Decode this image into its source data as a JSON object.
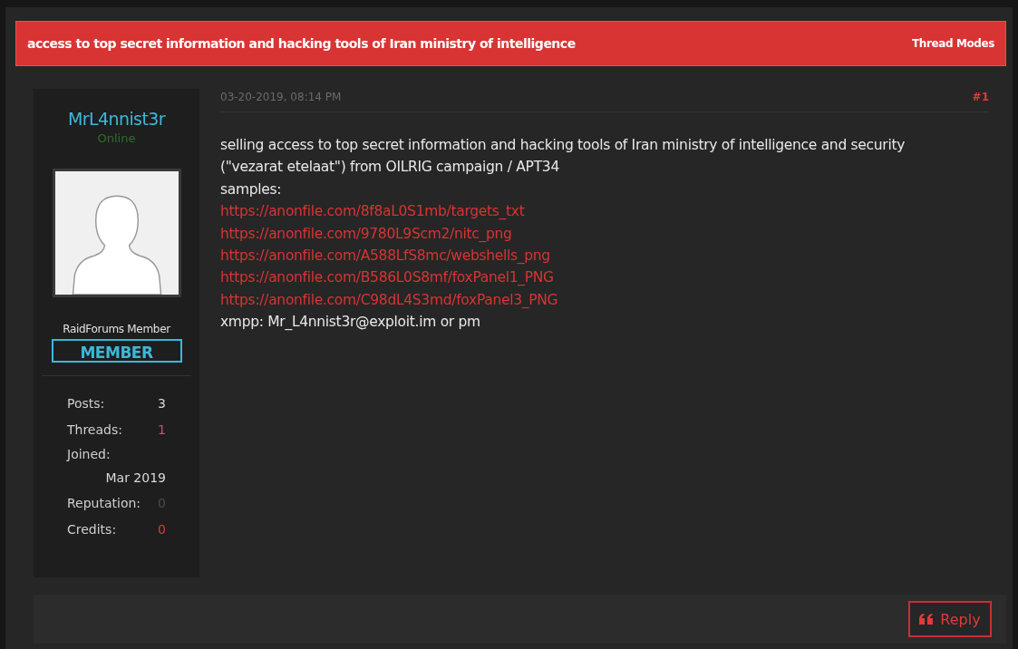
{
  "thread": {
    "title": "access to top secret information and hacking tools of Iran ministry of intelligence",
    "modes_link": "Thread Modes"
  },
  "post": {
    "date": "03-20-2019, 08:14 PM",
    "number": "#1",
    "author": {
      "name": "MrL4nnist3r",
      "status": "Online",
      "user_title": "RaidForums Member",
      "rank_badge": "MEMBER",
      "stats": [
        {
          "label": "Posts:",
          "value": "3",
          "kind": "inline",
          "color": "#d8d8d8"
        },
        {
          "label": "Threads:",
          "value": "1",
          "kind": "inline",
          "color": "#c9506a"
        },
        {
          "label": "Joined:",
          "value": "Mar 2019",
          "kind": "below",
          "color": "#d8d8d8"
        },
        {
          "label": "Reputation:",
          "value": "0",
          "kind": "inline",
          "color": "#4a4a4a"
        },
        {
          "label": "Credits:",
          "value": "0",
          "kind": "inline",
          "color": "#e03a3a"
        }
      ]
    },
    "body": [
      {
        "kind": "text",
        "text": "selling access to top secret information and hacking tools of Iran ministry of intelligence and security (\"vezarat etelaat\") from OILRIG campaign / APT34"
      },
      {
        "kind": "text",
        "text": "samples:"
      },
      {
        "kind": "link",
        "text": "https://anonfile.com/8f8aL0S1mb/targets_txt"
      },
      {
        "kind": "link",
        "text": "https://anonfile.com/9780L9Scm2/nitc_png"
      },
      {
        "kind": "link",
        "text": "https://anonfile.com/A588LfS8mc/webshells_png"
      },
      {
        "kind": "link",
        "text": "https://anonfile.com/B586L0S8mf/foxPanel1_PNG"
      },
      {
        "kind": "link",
        "text": "https://anonfile.com/C98dL4S3md/foxPanel3_PNG"
      },
      {
        "kind": "text",
        "text": "xmpp: Mr_L4nnist3r@exploit.im or pm"
      }
    ],
    "reply_button": "Reply"
  }
}
